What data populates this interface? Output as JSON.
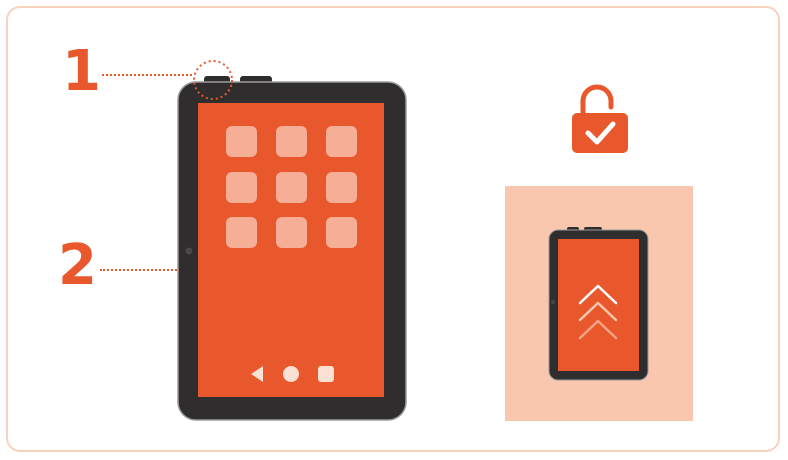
{
  "callouts": [
    {
      "label": "1",
      "meaning": "power-button"
    },
    {
      "label": "2",
      "meaning": "side-camera-or-sensor"
    }
  ],
  "colors": {
    "accent": "#E8582C",
    "device_body": "#2F2D2E",
    "panel_bg": "#F9C6AE",
    "frame_border": "#F8D2BD",
    "app_icon": "#F6AE96"
  },
  "icons": [
    "unlocked-padlock-check-icon",
    "swipe-up-chevrons-icon",
    "back-nav-icon",
    "home-nav-icon",
    "recents-nav-icon"
  ]
}
